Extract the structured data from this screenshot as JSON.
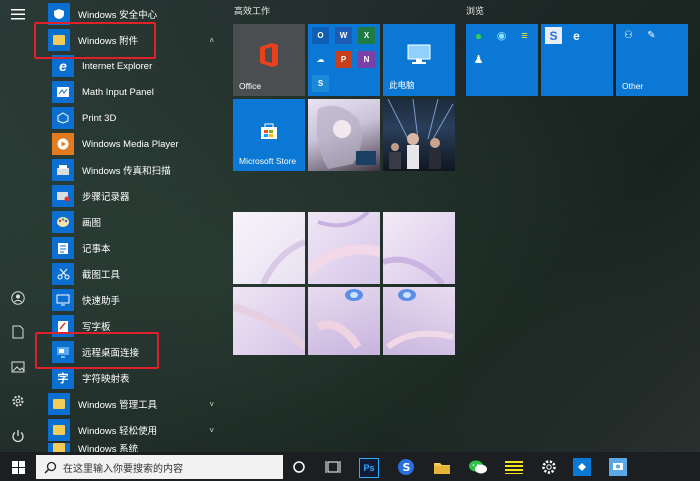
{
  "start_menu": {
    "rail": {
      "icons": [
        "hamburger-icon",
        "user-icon",
        "document-icon",
        "pictures-icon",
        "settings-icon",
        "power-icon"
      ]
    },
    "app_list": [
      {
        "label": "Windows 安全中心",
        "type": "app"
      },
      {
        "label": "Windows 附件",
        "type": "folder",
        "expanded": true,
        "chevron": "˄"
      },
      {
        "label": "Internet Explorer",
        "type": "sub"
      },
      {
        "label": "Math Input Panel",
        "type": "sub"
      },
      {
        "label": "Print 3D",
        "type": "sub"
      },
      {
        "label": "Windows Media Player",
        "type": "sub"
      },
      {
        "label": "Windows 传真和扫描",
        "type": "sub"
      },
      {
        "label": "步骤记录器",
        "type": "sub"
      },
      {
        "label": "画图",
        "type": "sub"
      },
      {
        "label": "记事本",
        "type": "sub"
      },
      {
        "label": "截图工具",
        "type": "sub"
      },
      {
        "label": "快速助手",
        "type": "sub"
      },
      {
        "label": "写字板",
        "type": "sub"
      },
      {
        "label": "远程桌面连接",
        "type": "sub"
      },
      {
        "label": "字符映射表",
        "type": "sub"
      },
      {
        "label": "Windows 管理工具",
        "type": "folder",
        "chevron": "˅"
      },
      {
        "label": "Windows 轻松使用",
        "type": "folder",
        "chevron": "˅"
      },
      {
        "label": "Windows 系统",
        "type": "folder",
        "chevron": "˅"
      }
    ],
    "sections": {
      "productivity": "高效工作",
      "browse": "浏览"
    },
    "tiles": {
      "office": "Office",
      "this_pc": "此电脑",
      "store": "Microsoft Store",
      "other": "Other"
    }
  },
  "taskbar": {
    "search_placeholder": "在这里输入你要搜索的内容",
    "pinned": [
      "task-view-icon",
      "photoshop-icon",
      "sogou-icon",
      "file-explorer-icon",
      "wechat-icon",
      "notes-icon",
      "settings-icon",
      "app-icon",
      "app2-icon"
    ]
  },
  "colors": {
    "accent": "#0b6fd1",
    "tile_blue": "#0a78d4",
    "highlight": "#e0202a",
    "folder": "#f3cc55"
  }
}
